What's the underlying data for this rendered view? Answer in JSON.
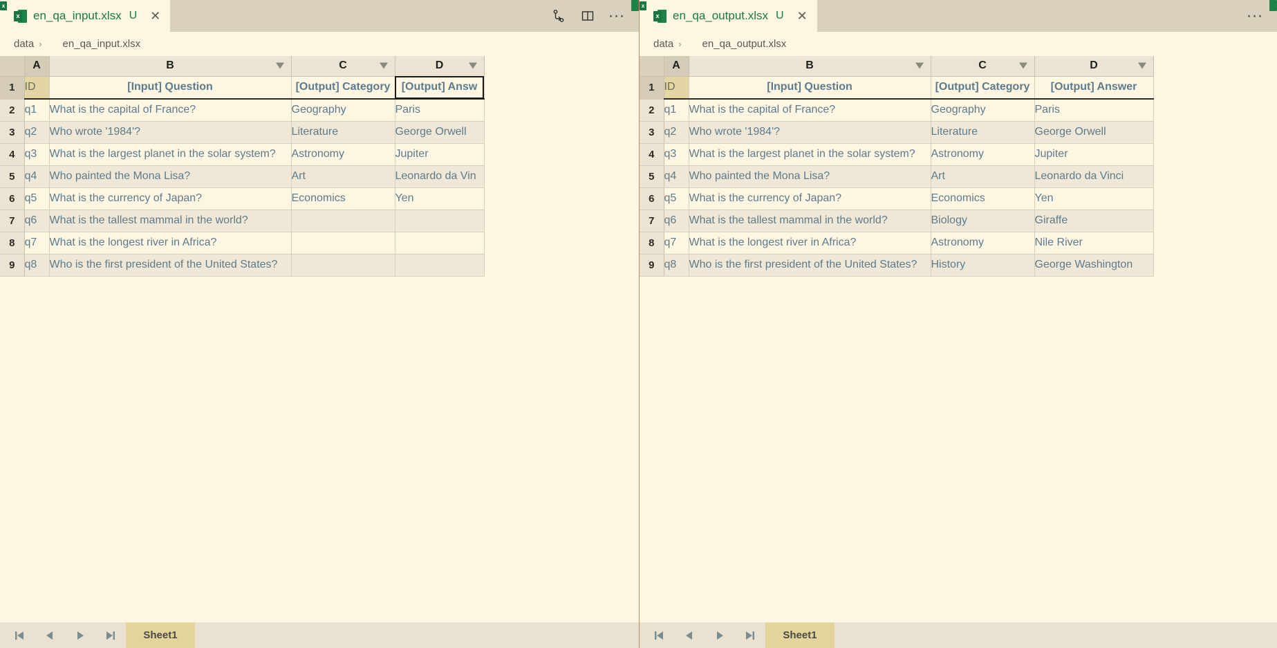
{
  "panels": [
    {
      "id": "left",
      "tab": {
        "label": "en_qa_input.xlsx",
        "dirty": "U",
        "close": "✕",
        "icon": "xlsx-file-icon"
      },
      "actions": [
        {
          "name": "source-control-icon",
          "label": ""
        },
        {
          "name": "split-editor-icon",
          "label": ""
        },
        {
          "name": "more-actions-icon",
          "label": "···"
        }
      ],
      "breadcrumb": {
        "folder": "data",
        "separator": "›",
        "file": "en_qa_input.xlsx"
      },
      "columns": [
        "",
        "A",
        "B",
        "C",
        "D"
      ],
      "filter_columns": [
        "B",
        "C",
        "D"
      ],
      "header_row": {
        "num": "1",
        "cells": [
          "ID",
          "[Input] Question",
          "[Output] Category",
          "[Output] Answ"
        ]
      },
      "rows": [
        {
          "num": "2",
          "id": "q1",
          "question": "What is the capital of France?",
          "category": "Geography",
          "answer": "Paris"
        },
        {
          "num": "3",
          "id": "q2",
          "question": "Who wrote '1984'?",
          "category": "Literature",
          "answer": "George Orwell"
        },
        {
          "num": "4",
          "id": "q3",
          "question": "What is the largest planet in the solar system?",
          "category": "Astronomy",
          "answer": "Jupiter"
        },
        {
          "num": "5",
          "id": "q4",
          "question": "Who painted the Mona Lisa?",
          "category": "Art",
          "answer": "Leonardo da Vin"
        },
        {
          "num": "6",
          "id": "q5",
          "question": "What is the currency of Japan?",
          "category": "Economics",
          "answer": "Yen"
        },
        {
          "num": "7",
          "id": "q6",
          "question": "What is the tallest mammal in the world?",
          "category": "",
          "answer": ""
        },
        {
          "num": "8",
          "id": "q7",
          "question": "What is the longest river in Africa?",
          "category": "",
          "answer": ""
        },
        {
          "num": "9",
          "id": "q8",
          "question": "Who is the first president of the United States?",
          "category": "",
          "answer": ""
        }
      ],
      "sheetbar": {
        "first": "first-sheet-icon",
        "prev": "previous-sheet-icon",
        "next": "next-sheet-icon",
        "last": "last-sheet-icon",
        "sheet": "Sheet1"
      }
    },
    {
      "id": "right",
      "tab": {
        "label": "en_qa_output.xlsx",
        "dirty": "U",
        "close": "✕",
        "icon": "xlsx-file-icon"
      },
      "actions": [
        {
          "name": "more-actions-icon",
          "label": "···"
        }
      ],
      "breadcrumb": {
        "folder": "data",
        "separator": "›",
        "file": "en_qa_output.xlsx"
      },
      "columns": [
        "",
        "A",
        "B",
        "C",
        "D"
      ],
      "filter_columns": [
        "B",
        "C",
        "D"
      ],
      "header_row": {
        "num": "1",
        "cells": [
          "ID",
          "[Input] Question",
          "[Output] Category",
          "[Output] Answer"
        ]
      },
      "rows": [
        {
          "num": "2",
          "id": "q1",
          "question": "What is the capital of France?",
          "category": "Geography",
          "answer": "Paris"
        },
        {
          "num": "3",
          "id": "q2",
          "question": "Who wrote '1984'?",
          "category": "Literature",
          "answer": "George Orwell"
        },
        {
          "num": "4",
          "id": "q3",
          "question": "What is the largest planet in the solar system?",
          "category": "Astronomy",
          "answer": "Jupiter"
        },
        {
          "num": "5",
          "id": "q4",
          "question": "Who painted the Mona Lisa?",
          "category": "Art",
          "answer": "Leonardo da Vinci"
        },
        {
          "num": "6",
          "id": "q5",
          "question": "What is the currency of Japan?",
          "category": "Economics",
          "answer": "Yen"
        },
        {
          "num": "7",
          "id": "q6",
          "question": "What is the tallest mammal in the world?",
          "category": "Biology",
          "answer": "Giraffe"
        },
        {
          "num": "8",
          "id": "q7",
          "question": "What is the longest river in Africa?",
          "category": "Astronomy",
          "answer": "Nile River"
        },
        {
          "num": "9",
          "id": "q8",
          "question": "Who is the first president of the United States?",
          "category": "History",
          "answer": "George Washington"
        }
      ],
      "sheetbar": {
        "first": "first-sheet-icon",
        "prev": "previous-sheet-icon",
        "next": "next-sheet-icon",
        "last": "last-sheet-icon",
        "sheet": "Sheet1"
      }
    }
  ],
  "colors": {
    "background": "#fdf6e3",
    "tabbar": "#d9d0bd",
    "grid_header": "#ebe4d3",
    "row_alt": "#efe8d6",
    "cell_text": "#5e7b8a",
    "tab_text_green": "#1a7a43",
    "sheet_tab_active": "#e3d49c",
    "id_header": "#e3d6a4"
  }
}
